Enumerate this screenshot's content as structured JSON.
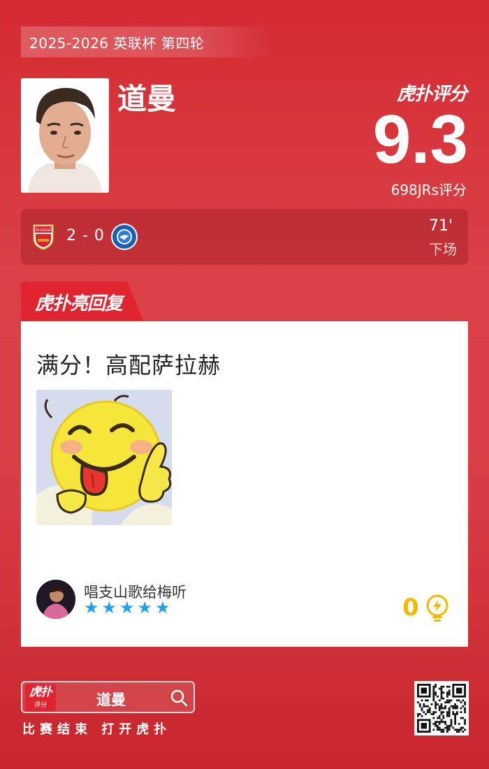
{
  "header": {
    "round": "2025-2026 英联杯 第四轮"
  },
  "player": {
    "name": "道曼"
  },
  "brand": {
    "logo_text": "虎扑评分"
  },
  "rating": {
    "score": "9.3",
    "count_label": "698JRs评分"
  },
  "match": {
    "home_team": "Arsenal",
    "away_team": "Brighton",
    "score": "2 - 0",
    "minute": "71'",
    "status": "下场"
  },
  "hot_reply": {
    "tab_label": "虎扑亮回复",
    "text": "满分！高配萨拉赫",
    "image": "smiling-emoji-thumbs-up",
    "user": "唱支山歌给梅听",
    "stars": [
      "★",
      "★",
      "★",
      "★",
      "★"
    ],
    "likes": "0"
  },
  "footer": {
    "badge_top": "虎扑",
    "badge_bottom": "评分",
    "search_term": "道曼",
    "caption": "比赛结束 打开虎扑"
  },
  "colors": {
    "accent": "#d52a32",
    "star": "#1ea1f2",
    "like": "#f5b800"
  }
}
